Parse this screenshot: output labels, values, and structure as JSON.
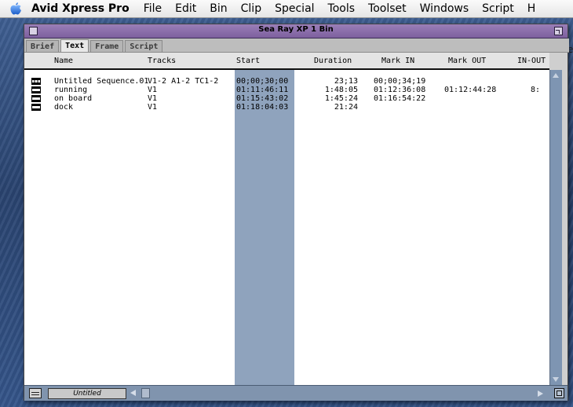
{
  "menubar": {
    "app_name": "Avid Xpress Pro",
    "items": [
      "File",
      "Edit",
      "Bin",
      "Clip",
      "Special",
      "Tools",
      "Toolset",
      "Windows",
      "Script"
    ],
    "overflow_letter": "H"
  },
  "window": {
    "title": "Sea Ray XP 1 Bin",
    "colors": {
      "title_bar": "#8a6dae",
      "start_column_highlight": "#8fa3bd",
      "scrollbar": "#7e95b2"
    }
  },
  "tabs": [
    {
      "label": "Brief",
      "active": false
    },
    {
      "label": "Text",
      "active": true
    },
    {
      "label": "Frame",
      "active": false
    },
    {
      "label": "Script",
      "active": false
    }
  ],
  "columns": {
    "name": "Name",
    "tracks": "Tracks",
    "start": "Start",
    "duration": "Duration",
    "mark_in": "Mark IN",
    "mark_out": "Mark OUT",
    "in_out": "IN-OUT"
  },
  "rows": [
    {
      "icon": "sequence-icon",
      "name": "Untitled Sequence.01",
      "tracks": "V1-2 A1-2 TC1-2",
      "start": "00;00;30;00",
      "duration": "23;13",
      "mark_in": "00;00;34;19",
      "mark_out": "",
      "in_out": ""
    },
    {
      "icon": "clip-icon",
      "name": "running",
      "tracks": "V1",
      "start": "01:11:46:11",
      "duration": "1:48:05",
      "mark_in": "01:12:36:08",
      "mark_out": "01:12:44:28",
      "in_out": "8:"
    },
    {
      "icon": "clip-icon",
      "name": "on board",
      "tracks": "V1",
      "start": "01:15:43:02",
      "duration": "1:45:24",
      "mark_in": "01:16:54:22",
      "mark_out": "",
      "in_out": ""
    },
    {
      "icon": "clip-icon",
      "name": "dock",
      "tracks": "V1",
      "start": "01:18:04:03",
      "duration": "21:24",
      "mark_in": "",
      "mark_out": "",
      "in_out": ""
    }
  ],
  "bottombar": {
    "bin_view_name": "Untitled"
  },
  "peek_text": "e"
}
